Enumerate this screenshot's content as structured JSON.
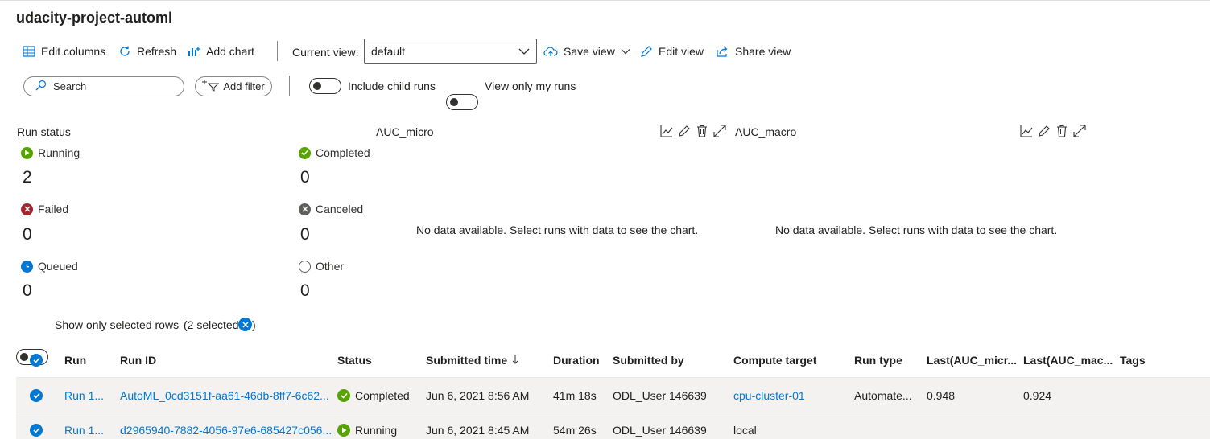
{
  "title": "udacity-project-automl",
  "toolbar": {
    "edit_columns": "Edit columns",
    "refresh": "Refresh",
    "add_chart": "Add chart",
    "current_view_label": "Current view:",
    "current_view_value": "default",
    "save_view": "Save view",
    "edit_view": "Edit view",
    "share_view": "Share view"
  },
  "filters": {
    "search_placeholder": "Search",
    "add_filter": "Add filter",
    "include_child_runs": "Include child runs",
    "view_only_my_runs": "View only my runs"
  },
  "run_status": {
    "title": "Run status",
    "items": [
      {
        "label": "Running",
        "value": "2",
        "color": "#57a300"
      },
      {
        "label": "Completed",
        "value": "0",
        "color": "#57a300"
      },
      {
        "label": "Failed",
        "value": "0",
        "color": "#a4262c"
      },
      {
        "label": "Canceled",
        "value": "0",
        "color": "#605e5c"
      },
      {
        "label": "Queued",
        "value": "0",
        "color": "#0078d4"
      },
      {
        "label": "Other",
        "value": "0",
        "color": "#605e5c"
      }
    ]
  },
  "charts": [
    {
      "title": "AUC_micro",
      "message": "No data available. Select runs with data to see the chart."
    },
    {
      "title": "AUC_macro",
      "message": "No data available. Select runs with data to see the chart."
    }
  ],
  "selection": {
    "show_only_selected": "Show only selected rows",
    "selected_count": "(2 selected"
  },
  "table": {
    "headers": [
      "Run",
      "Run ID",
      "Status",
      "Submitted time",
      "Duration",
      "Submitted by",
      "Compute target",
      "Run type",
      "Last(AUC_micr...",
      "Last(AUC_mac...",
      "Tags"
    ],
    "rows": [
      {
        "run": "Run 1...",
        "run_id": "AutoML_0cd3151f-aa61-46db-8ff7-6c62...",
        "status": "Completed",
        "submitted": "Jun 6, 2021 8:56 AM",
        "duration": "41m 18s",
        "by": "ODL_User 146639",
        "compute": "cpu-cluster-01",
        "type": "Automate...",
        "auc_micro": "0.948",
        "auc_macro": "0.924",
        "tags": ""
      },
      {
        "run": "Run 1...",
        "run_id": "d2965940-7882-4056-97e6-685427c056...",
        "status": "Running",
        "submitted": "Jun 6, 2021 8:45 AM",
        "duration": "54m 26s",
        "by": "ODL_User 146639",
        "compute": "local",
        "type": "",
        "auc_micro": "",
        "auc_macro": "",
        "tags": ""
      }
    ]
  },
  "colors": {
    "accent": "#0078d4",
    "success": "#57a300",
    "error": "#a4262c"
  }
}
